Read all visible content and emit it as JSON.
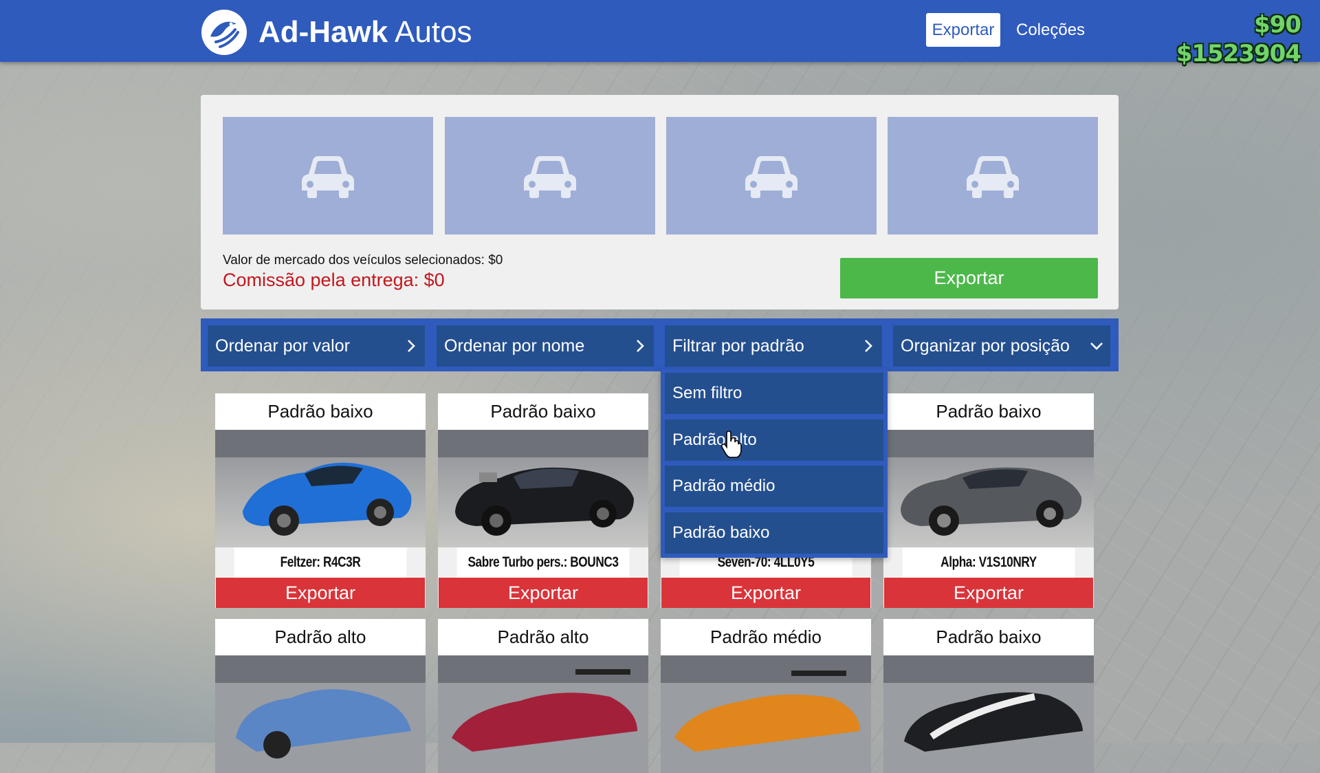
{
  "header": {
    "brand_bold": "Ad-Hawk",
    "brand_light": "Autos",
    "nav_export": "Exportar",
    "nav_collections": "Coleções",
    "cash": "$90",
    "bank": "$1523904"
  },
  "selection": {
    "slots": [
      "car-icon",
      "car-icon",
      "car-icon",
      "car-icon"
    ],
    "market_value": "Valor de mercado dos veículos selecionados: $0",
    "commission": "Comissão pela entrega: $0",
    "export_label": "Exportar"
  },
  "filters": [
    {
      "label": "Ordenar por valor",
      "icon": "chevron-right-icon"
    },
    {
      "label": "Ordenar por nome",
      "icon": "chevron-right-icon"
    },
    {
      "label": "Filtrar por padrão",
      "icon": "chevron-right-icon"
    },
    {
      "label": "Organizar por posição",
      "icon": "chevron-down-icon"
    }
  ],
  "dropdown": {
    "items": [
      "Sem filtro",
      "Padrão alto",
      "Padrão médio",
      "Padrão baixo"
    ],
    "hovered": "Padrão alto"
  },
  "cards": [
    {
      "grade": "Padrão baixo",
      "name": "Feltzer: R4C3R",
      "export": "Exportar"
    },
    {
      "grade": "Padrão baixo",
      "name": "Sabre Turbo pers.: BOUNC3",
      "export": "Exportar"
    },
    {
      "grade": "",
      "name": "Seven-70: 4LL0Y5",
      "export": "Exportar"
    },
    {
      "grade": "Padrão baixo",
      "name": "Alpha: V1S10NRY",
      "export": "Exportar"
    },
    {
      "grade": "Padrão alto"
    },
    {
      "grade": "Padrão alto"
    },
    {
      "grade": "Padrão médio"
    },
    {
      "grade": "Padrão baixo"
    }
  ],
  "colors": {
    "header_blue": "#2f5bbd",
    "button_blue": "#244f8f",
    "export_green": "#4cb84a",
    "export_red": "#d9343a",
    "commission_red": "#c2161d",
    "money_green": "#72d46b",
    "slot_blue": "#9eaed6"
  }
}
